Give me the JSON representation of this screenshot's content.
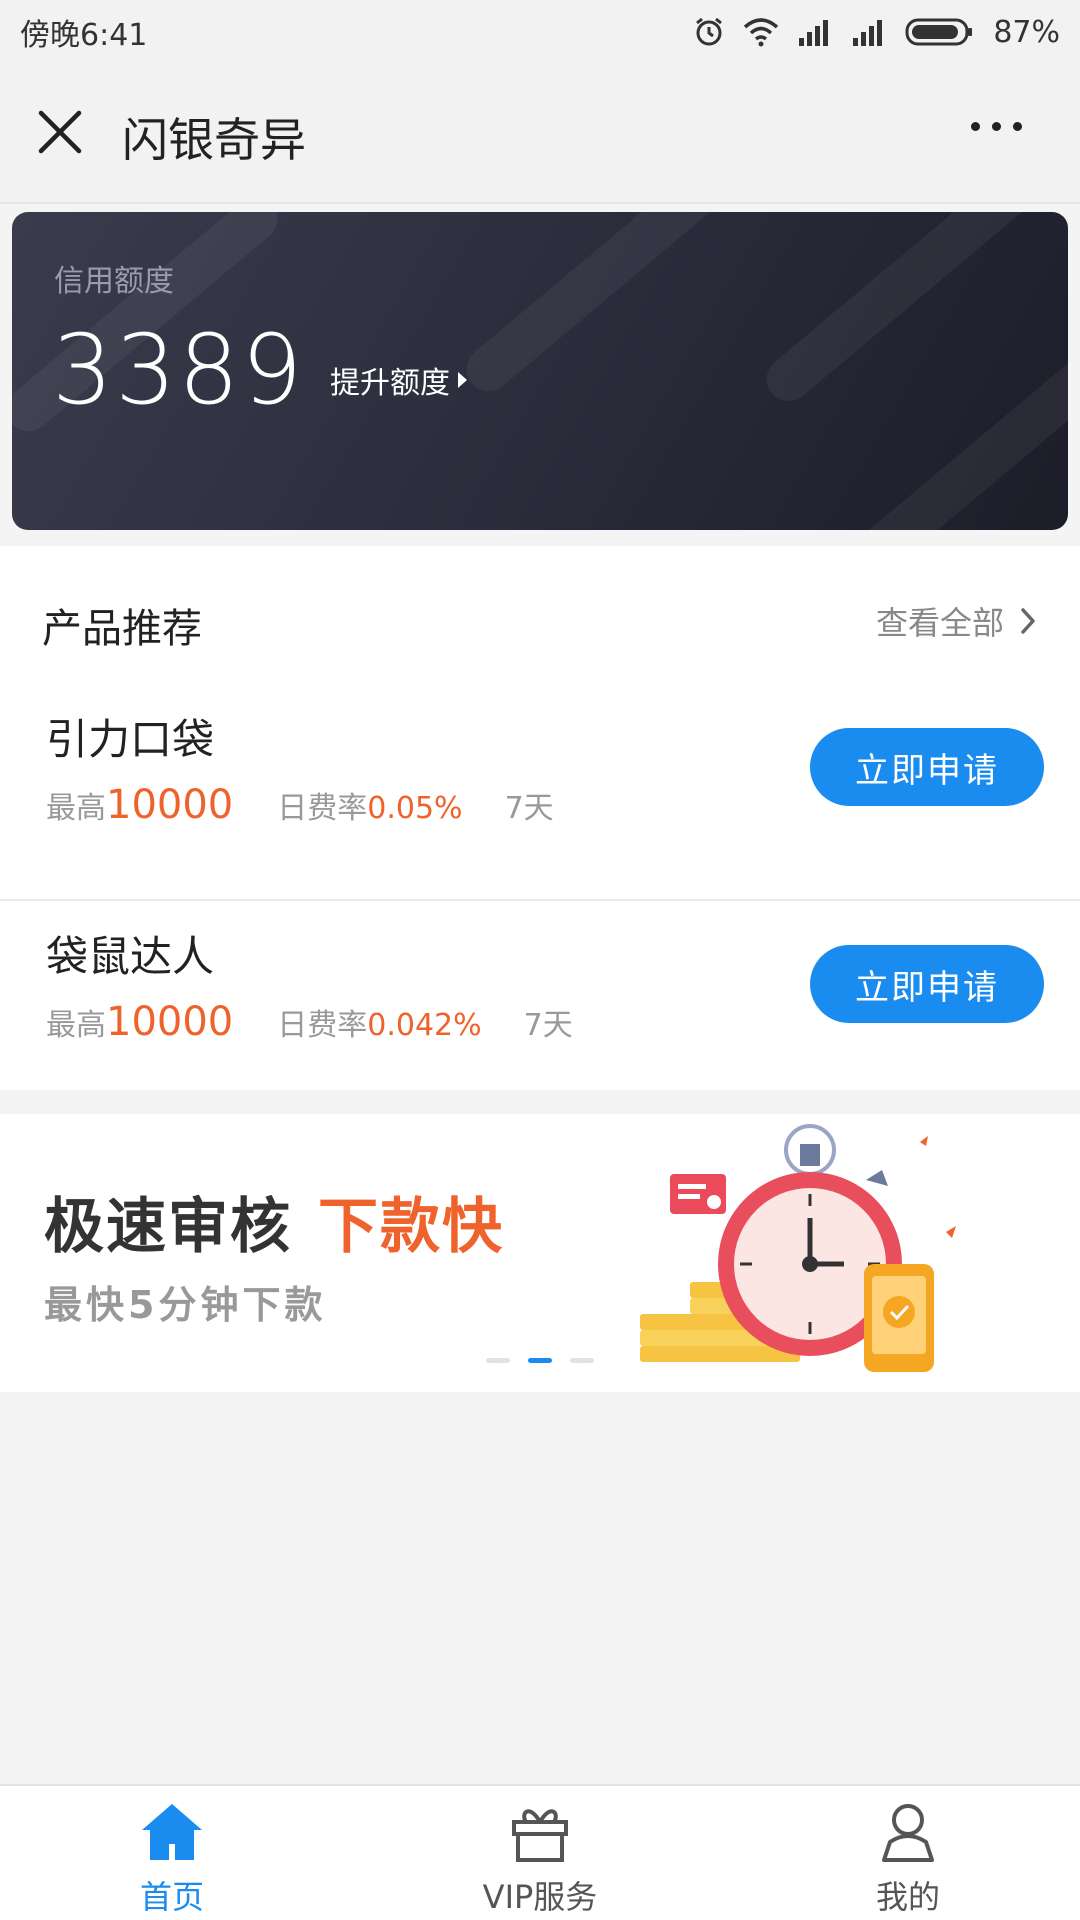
{
  "status_bar": {
    "time": "傍晚6:41",
    "battery": "87%"
  },
  "header": {
    "title": "闪银奇异"
  },
  "credit": {
    "label": "信用额度",
    "value": "3389",
    "raise_label": "提升额度"
  },
  "products": {
    "section_title": "产品推荐",
    "view_all": "查看全部",
    "items": [
      {
        "name": "引力口袋",
        "max_prefix": "最高",
        "max_amount": "10000",
        "rate_prefix": "日费率",
        "rate": "0.05%",
        "term": "7天",
        "apply": "立即申请"
      },
      {
        "name": "袋鼠达人",
        "max_prefix": "最高",
        "max_amount": "10000",
        "rate_prefix": "日费率",
        "rate": "0.042%",
        "term": "7天",
        "apply": "立即申请"
      }
    ]
  },
  "banner": {
    "title": "极速审核",
    "title_accent": "下款快",
    "subtitle": "最快5分钟下款",
    "active_slide": 2,
    "slide_count": 3
  },
  "tab_bar": {
    "tabs": [
      {
        "label": "首页",
        "icon": "home-icon",
        "active": true
      },
      {
        "label": "VIP服务",
        "icon": "gift-icon",
        "active": false
      },
      {
        "label": "我的",
        "icon": "user-icon",
        "active": false
      }
    ]
  },
  "colors": {
    "primary": "#1a8cef",
    "accent": "#f0622c",
    "card_dark": "#2b2d3c"
  }
}
